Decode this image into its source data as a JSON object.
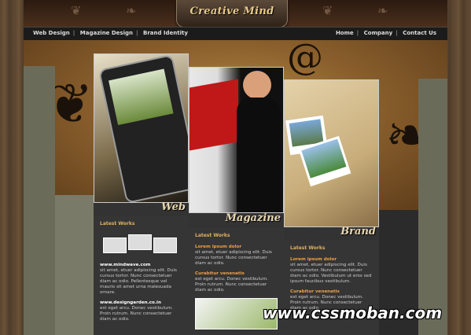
{
  "header": {
    "logo_text": "Creative Mind"
  },
  "nav": {
    "left": [
      "Web Design",
      "Magazine Design",
      "Brand Identity"
    ],
    "right": [
      "Home",
      "Company",
      "Contact Us"
    ]
  },
  "panels": [
    {
      "caption": "Web"
    },
    {
      "caption": "Magazine"
    },
    {
      "caption": "Brand"
    }
  ],
  "columns": [
    {
      "title": "Latest Works",
      "items": [
        {
          "link": "www.mindwave.com",
          "text": "sit amet, etuer adipiscing elit. Duis cursus tortor. Nunc consectetuer diam ac odio. Pellentesque vel mauris sit amet urna malesuada ornare."
        },
        {
          "link": "www.designgarden.co.in",
          "text": "est eget arcu. Donec vestibulum. Proin rutrum. Nunc consectetuer diam ac odio."
        }
      ]
    },
    {
      "title": "Latest Works",
      "items": [
        {
          "heading": "Lorem ipsum dolor",
          "text": "sit amet, etuer adipiscing elit. Duis cursus tortor. Nunc consectetuer diam ac odio."
        },
        {
          "heading": "Curabitur venenatis",
          "text": "est eget arcu. Donec vestibulum. Proin rutrum. Nunc consectetuer diam ac odio."
        }
      ]
    },
    {
      "title": "Latest Works",
      "items": [
        {
          "heading": "Lorem ipsum dolor",
          "text": "sit amet, etuer adipiscing elit. Duis cursus tortor. Nunc consectetuer diam ac odio. Vestibulum ut eros sed ipsum faucibus vestibulum."
        },
        {
          "heading": "Curabitur venenatis",
          "text": "est eget arcu. Donec vestibulum. Proin rutrum. Nunc consectetuer diam ac odio."
        }
      ]
    }
  ],
  "watermark": "www.cssmoban.com",
  "colors": {
    "accent": "#e0b060",
    "link_heading": "#f0a040",
    "logo": "#e6c988"
  }
}
